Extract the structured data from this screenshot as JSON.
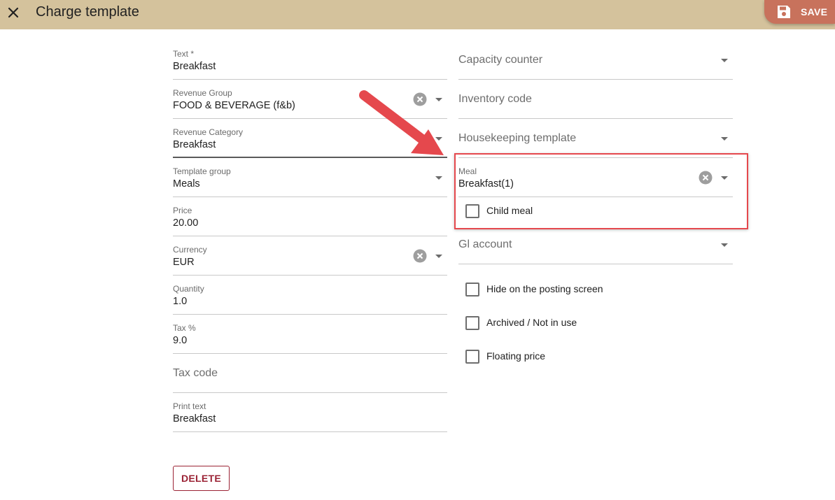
{
  "header": {
    "title": "Charge template",
    "save_label": "SAVE",
    "close_icon": "close-icon",
    "save_icon": "floppy-disk-icon"
  },
  "form_left": {
    "text": {
      "label": "Text *",
      "value": "Breakfast"
    },
    "revenue_group": {
      "label": "Revenue Group",
      "value": "FOOD & BEVERAGE (f&b)"
    },
    "revenue_category": {
      "label": "Revenue Category",
      "value": "Breakfast"
    },
    "template_group": {
      "label": "Template group",
      "value": "Meals"
    },
    "price": {
      "label": "Price",
      "value": "20.00"
    },
    "currency": {
      "label": "Currency",
      "value": "EUR"
    },
    "quantity": {
      "label": "Quantity",
      "value": "1.0"
    },
    "tax_percent": {
      "label": "Tax %",
      "value": "9.0"
    },
    "tax_code": {
      "placeholder": "Tax code"
    },
    "print_text": {
      "label": "Print text",
      "value": "Breakfast"
    }
  },
  "form_right": {
    "capacity_counter": {
      "placeholder": "Capacity counter"
    },
    "inventory_code": {
      "placeholder": "Inventory code"
    },
    "housekeeping_template": {
      "placeholder": "Housekeeping template"
    },
    "meal": {
      "label": "Meal",
      "value": "Breakfast(1)"
    },
    "child_meal": {
      "label": "Child meal",
      "checked": false
    },
    "gl_account": {
      "placeholder": "Gl account"
    },
    "hide_on_posting": {
      "label": "Hide on the posting screen",
      "checked": false
    },
    "archived": {
      "label": "Archived / Not in use",
      "checked": false
    },
    "floating_price": {
      "label": "Floating price",
      "checked": false
    }
  },
  "actions": {
    "delete_label": "DELETE"
  },
  "colors": {
    "header_bg": "#d4c29c",
    "save_bg": "#c8725c",
    "delete": "#9b2335",
    "annotation": "#e5484d"
  }
}
